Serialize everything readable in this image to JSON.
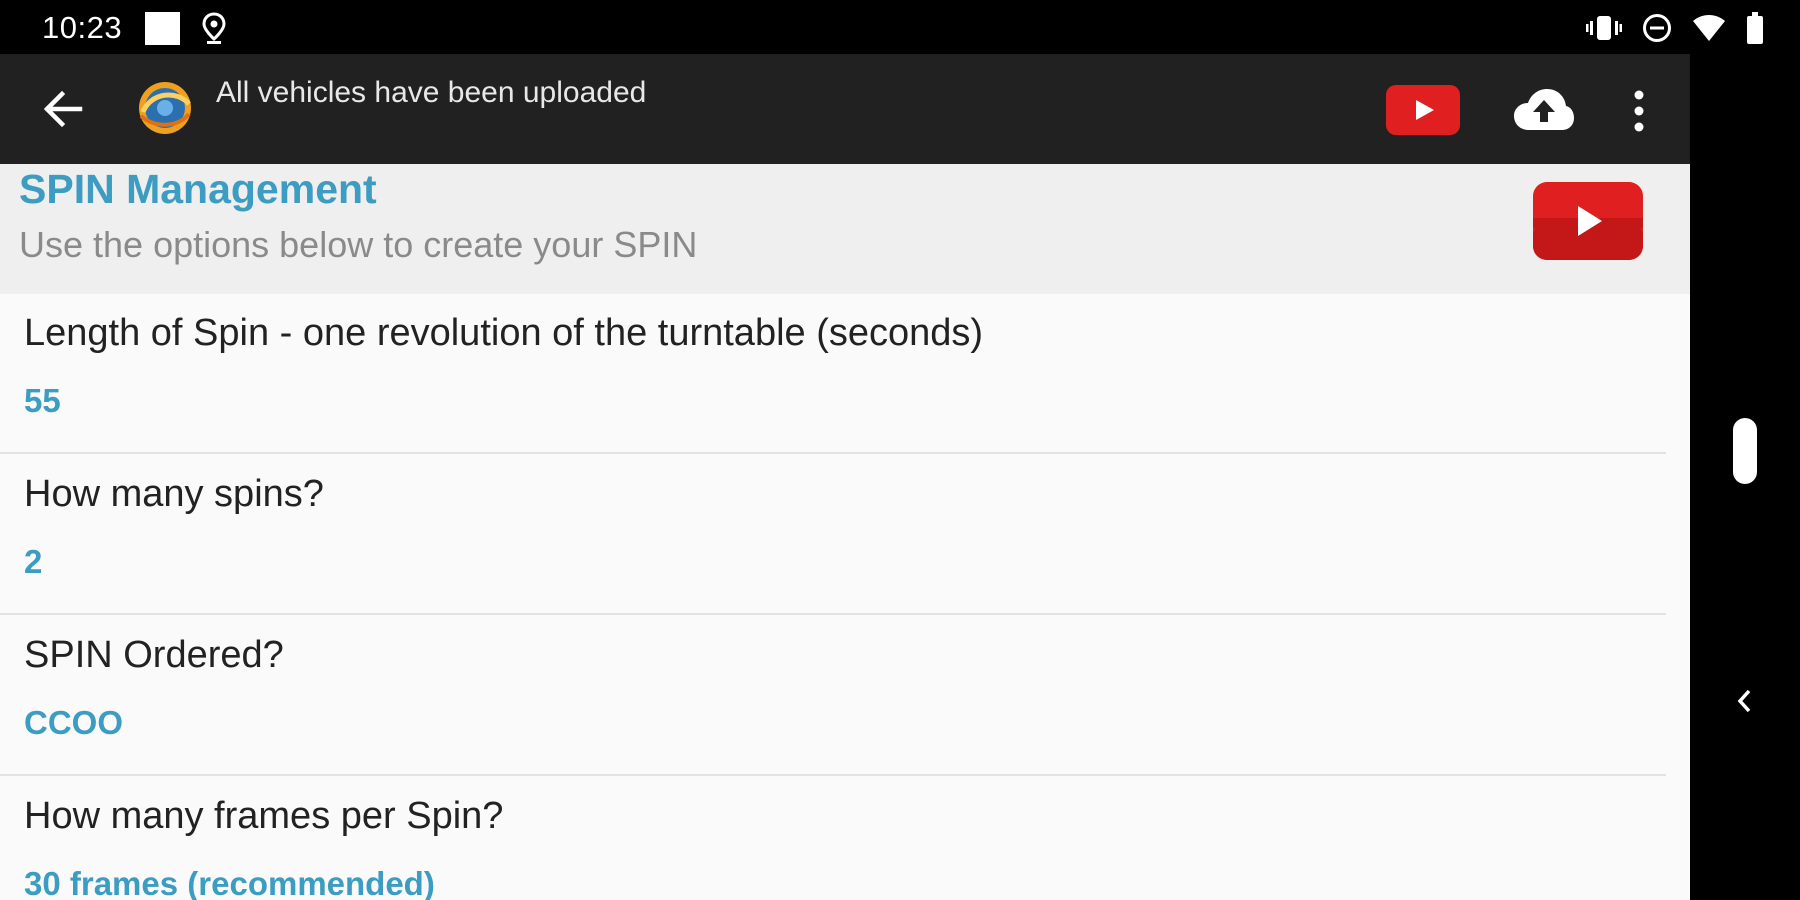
{
  "status_bar": {
    "time": "10:23",
    "icons": [
      "notification-square-icon",
      "location-pin-icon",
      "vibrate-icon",
      "do-not-disturb-icon",
      "wifi-icon",
      "battery-icon"
    ]
  },
  "app_bar": {
    "title": "All vehicles have been uploaded",
    "icons": [
      "back-arrow-icon",
      "app-logo",
      "youtube-icon",
      "cloud-upload-icon",
      "more-vert-icon"
    ]
  },
  "header": {
    "title": "SPIN Management",
    "subtitle": "Use the options below to create your SPIN"
  },
  "preferences": [
    {
      "title": "Length of Spin - one revolution of the turntable (seconds)",
      "value": "55"
    },
    {
      "title": "How many spins?",
      "value": "2"
    },
    {
      "title": "SPIN Ordered?",
      "value": "CCOO"
    },
    {
      "title": "How many frames per Spin?",
      "value": "30 frames (recommended)"
    }
  ],
  "colors": {
    "accent": "#3c9cc2",
    "app_bar": "#212121",
    "youtube_red": "#e02020",
    "content_bg": "#fafafa",
    "header_bg": "#efefef"
  }
}
